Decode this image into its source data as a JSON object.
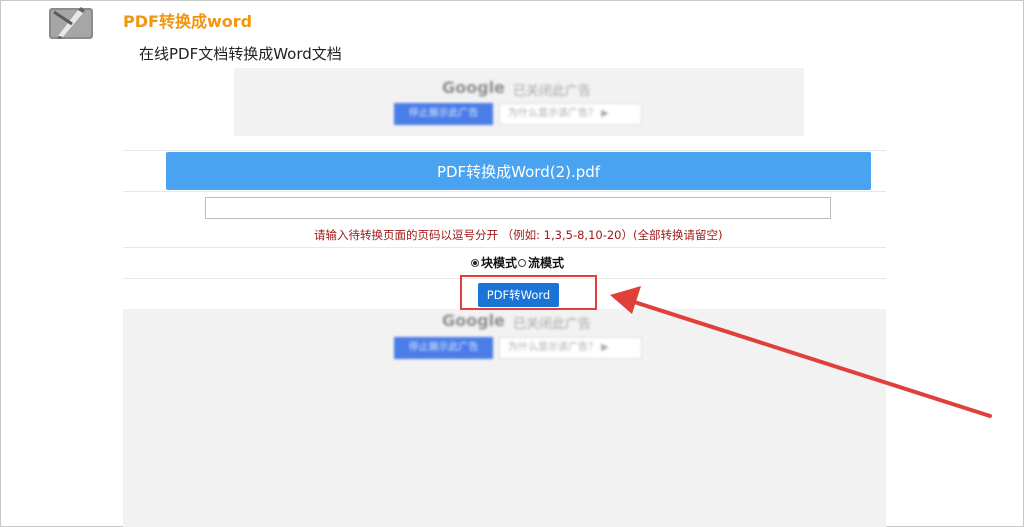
{
  "header": {
    "title": "PDF转换成word",
    "subtitle": "在线PDF文档转换成Word文档",
    "icon": "pdf-pen-icon"
  },
  "ads": {
    "brand": "Google",
    "closed_text": "已关闭此广告",
    "stop_label": "停止展示此广告",
    "why_label": "为什么显示该广告？ ▶"
  },
  "file": {
    "name": "PDF转换成Word(2).pdf"
  },
  "pages": {
    "value": "",
    "hint": "请输入待转换页面的页码以逗号分开 （例如: 1,3,5-8,10-20）(全部转换请留空)"
  },
  "mode": {
    "block_label": "块模式",
    "flow_label": "流模式",
    "selected": "block"
  },
  "actions": {
    "convert_label": "PDF转Word"
  },
  "colors": {
    "title": "#f2950f",
    "file_bar": "#4aa3f0",
    "button": "#1a73d6",
    "hint": "#a01818",
    "annotation": "#e0403a"
  }
}
